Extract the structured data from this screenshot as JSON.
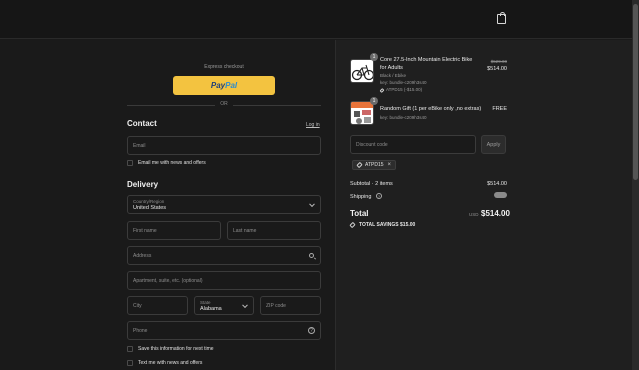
{
  "header": {
    "logo": "",
    "cart_icon": "bag-icon"
  },
  "express": {
    "label": "Express checkout",
    "paypal_part1": "Pay",
    "paypal_part2": "Pal",
    "or": "OR"
  },
  "contact": {
    "title": "Contact",
    "login": "Log in",
    "email_placeholder": "Email",
    "newsletter": "Email me with news and offers"
  },
  "delivery": {
    "title": "Delivery",
    "country_label": "Country/Region",
    "country_value": "United States",
    "first_name": "First name",
    "last_name": "Last name",
    "address": "Address",
    "apartment": "Apartment, suite, etc. (optional)",
    "city": "City",
    "state_label": "State",
    "state_value": "Alabama",
    "zip": "ZIP code",
    "phone": "Phone",
    "save_info": "Save this information for next time",
    "text_me": "Text me with news and offers"
  },
  "cart": {
    "items": [
      {
        "qty": "1",
        "title": "Core 27.5-Inch Mountain Electric Bike for Adults",
        "variant": "Black / Ebike",
        "key": "key: bundle-c209h3s40",
        "discount": "ATPD15 (-$15.00)",
        "price_original": "$529.00",
        "price": "$514.00"
      },
      {
        "qty": "1",
        "title": "Random Gift (1 per eBike only ,no extras)",
        "key": "key: bundle-c209h3s40",
        "price": "FREE"
      }
    ],
    "discount_placeholder": "Discount code",
    "apply": "Apply",
    "applied_code": "ATPD15"
  },
  "summary": {
    "subtotal_label": "Subtotal · 2 items",
    "subtotal_value": "$514.00",
    "shipping_label": "Shipping",
    "total_label": "Total",
    "currency": "USD",
    "total_value": "$514.00",
    "savings": "TOTAL SAVINGS  $15.00"
  },
  "colors": {
    "paypal": "#f3c340",
    "background": "#1a1a1a",
    "panel": "#1f1f1f"
  }
}
